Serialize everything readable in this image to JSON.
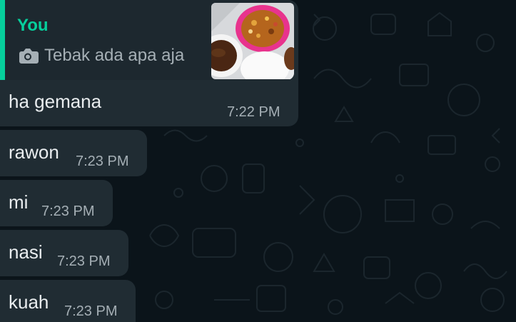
{
  "chat": {
    "reply_message": {
      "quote": {
        "author": "You",
        "caption": "Tebak ada apa aja",
        "caption_icon": "camera-icon",
        "thumbnail": "food-photo-thumbnail"
      },
      "text": "ha gemana",
      "time": "7:22 PM"
    },
    "messages": [
      {
        "text": "rawon",
        "time": "7:23 PM"
      },
      {
        "text": "mi",
        "time": "7:23 PM"
      },
      {
        "text": "nasi",
        "time": "7:23 PM"
      },
      {
        "text": "kuah",
        "time": "7:23 PM"
      }
    ]
  },
  "colors": {
    "background": "#0b141a",
    "bubble": "#202c33",
    "quote_background": "#1d282f",
    "accent": "#06cf9c",
    "text": "#e9edef",
    "time": "#a5afb5"
  }
}
